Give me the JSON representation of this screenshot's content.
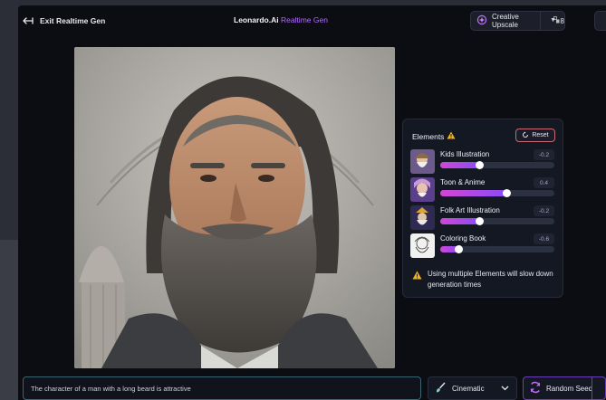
{
  "topbar": {
    "exit_label": "Exit Realtime Gen",
    "brand_name": "Leonardo.Ai",
    "brand_suffix": "Realtime Gen",
    "upscale_label": "Creative Upscale",
    "upscale_tokens": "8"
  },
  "elements_panel": {
    "title": "Elements",
    "reset_label": "Reset",
    "items": [
      {
        "label": "Kids Illustration",
        "value": "-0.2",
        "level": 0.34
      },
      {
        "label": "Toon & Anime",
        "value": "0.4",
        "level": 0.58
      },
      {
        "label": "Folk Art Illustration",
        "value": "-0.2",
        "level": 0.34
      },
      {
        "label": "Coloring Book",
        "value": "-0.6",
        "level": 0.16
      }
    ],
    "warning": "Using multiple Elements will slow down generation times"
  },
  "bottom": {
    "prompt_value": "The character of a man with a long beard is attractive",
    "style_label": "Cinematic",
    "seed_label": "Random Seed"
  },
  "colors": {
    "accent": "#b06cff",
    "warning": "#f2b21d",
    "reset_border": "#c86b73",
    "slider_gradient_start": "#d346d4",
    "slider_gradient_end": "#8a4cf6"
  },
  "icons": [
    "arrow-left-icon",
    "sparkle-upscale-icon",
    "token-icon",
    "chevron-down-icon",
    "warning-icon",
    "reset-icon",
    "style-brush-icon",
    "random-seed-icon"
  ]
}
